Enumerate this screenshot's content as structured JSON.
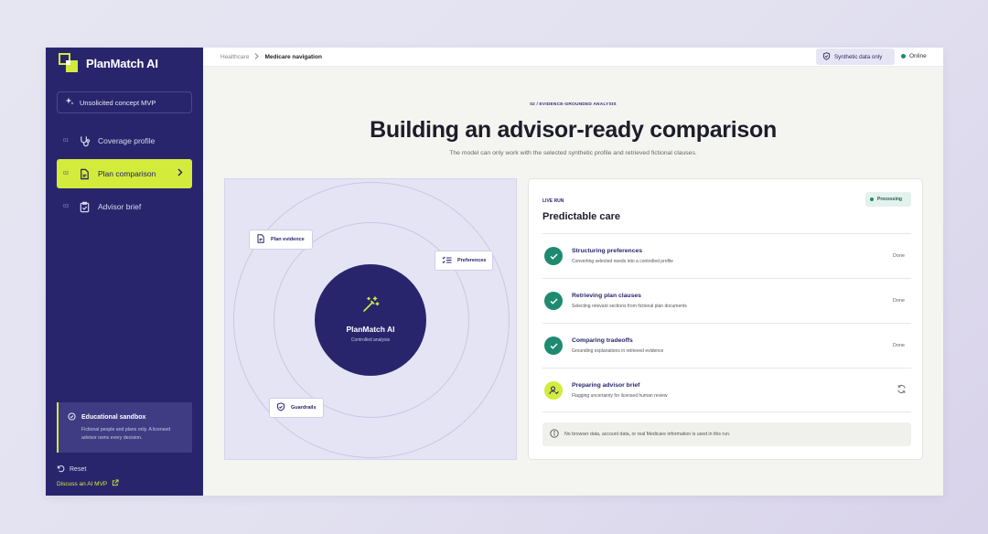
{
  "app": {
    "name": "PlanMatch AI"
  },
  "sidebar": {
    "concept_label": "Unsolicited concept MVP",
    "items": [
      {
        "num": "01",
        "label": "Coverage profile",
        "icon": "stethoscope-icon"
      },
      {
        "num": "02",
        "label": "Plan comparison",
        "icon": "document-icon",
        "active": true
      },
      {
        "num": "03",
        "label": "Advisor brief",
        "icon": "clipboard-check-icon"
      }
    ],
    "sandbox": {
      "title": "Educational sandbox",
      "text": "Fictional people and plans only. A licensed advisor owns every decision."
    },
    "reset_label": "Reset",
    "discuss_label": "Discuss an AI MVP"
  },
  "topbar": {
    "breadcrumb": [
      "Healthcare",
      "Medicare navigation"
    ],
    "synthetic_label": "Synthetic data only",
    "online_label": "Online"
  },
  "hero": {
    "eyebrow": "02 / EVIDENCE-GROUNDED ANALYSIS",
    "title": "Building an advisor-ready comparison",
    "subtitle": "The model can only work with the selected synthetic profile and retrieved fictional clauses."
  },
  "orbit": {
    "core_title": "PlanMatch AI",
    "core_subtitle": "Controlled analysis",
    "chips": {
      "plan_evidence": "Plan evidence",
      "preferences": "Preferences",
      "guardrails": "Guardrails"
    }
  },
  "run": {
    "eyebrow": "LIVE RUN",
    "title": "Predictable care",
    "status": "Processing",
    "steps": [
      {
        "title": "Structuring preferences",
        "desc": "Converting selected needs into a controlled profile",
        "status": "Done"
      },
      {
        "title": "Retrieving plan clauses",
        "desc": "Selecting relevant sections from fictional plan documents",
        "status": "Done"
      },
      {
        "title": "Comparing tradeoffs",
        "desc": "Grounding explanations in retrieved evidence",
        "status": "Done"
      },
      {
        "title": "Preparing advisor brief",
        "desc": "Flagging uncertainty for licensed human review",
        "status": ""
      }
    ],
    "note": "No browser data, account data, or real Medicare information is used in this run."
  },
  "colors": {
    "navy": "#29256d",
    "lime": "#d3ec3c",
    "green": "#1f8a70"
  }
}
